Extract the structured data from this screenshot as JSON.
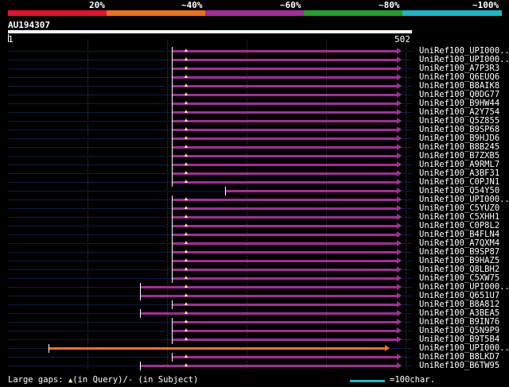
{
  "legend": {
    "labels": [
      "20%",
      "~40%",
      "~60%",
      "~80%",
      "~100%"
    ],
    "colors": [
      "#e8102a",
      "#ee7118",
      "#a82a9c",
      "#22a02a",
      "#18b8c8"
    ]
  },
  "query": {
    "id": "AU194307",
    "start": "1",
    "end": "502"
  },
  "colors": {
    "line": "#a82a9c",
    "context": "#0d1e45",
    "hit_orange": "#ee7118",
    "marker": "#ffee88"
  },
  "hits": [
    {
      "name": "UniRef100_UPI000..",
      "start": 216,
      "end": 505,
      "color": "purple"
    },
    {
      "name": "UniRef100_UPI000..",
      "start": 216,
      "end": 505,
      "color": "purple"
    },
    {
      "name": "UniRef100_A7P3R3",
      "start": 216,
      "end": 505,
      "color": "purple"
    },
    {
      "name": "UniRef100_Q6EUQ6",
      "start": 216,
      "end": 505,
      "color": "purple"
    },
    {
      "name": "UniRef100_B8AIK8",
      "start": 216,
      "end": 505,
      "color": "purple"
    },
    {
      "name": "UniRef100_Q0DG77",
      "start": 216,
      "end": 505,
      "color": "purple"
    },
    {
      "name": "UniRef100_B9HW44",
      "start": 216,
      "end": 505,
      "color": "purple"
    },
    {
      "name": "UniRef100_A2Y754",
      "start": 216,
      "end": 505,
      "color": "purple"
    },
    {
      "name": "UniRef100_Q5Z855",
      "start": 216,
      "end": 505,
      "color": "purple"
    },
    {
      "name": "UniRef100_B9SP68",
      "start": 216,
      "end": 505,
      "color": "purple"
    },
    {
      "name": "UniRef100_B9HJD6",
      "start": 216,
      "end": 505,
      "color": "purple"
    },
    {
      "name": "UniRef100_B8B245",
      "start": 216,
      "end": 505,
      "color": "purple"
    },
    {
      "name": "UniRef100_B7ZXB5",
      "start": 216,
      "end": 505,
      "color": "purple"
    },
    {
      "name": "UniRef100_A9RML7",
      "start": 216,
      "end": 505,
      "color": "purple"
    },
    {
      "name": "UniRef100_A3BF31",
      "start": 216,
      "end": 505,
      "color": "purple"
    },
    {
      "name": "UniRef100_C0PJN1",
      "start": 216,
      "end": 505,
      "color": "purple"
    },
    {
      "name": "UniRef100_Q54Y50",
      "start": 283,
      "end": 505,
      "color": "purple"
    },
    {
      "name": "UniRef100_UPI000..",
      "start": 216,
      "end": 505,
      "color": "purple"
    },
    {
      "name": "UniRef100_C5YUZ0",
      "start": 216,
      "end": 505,
      "color": "purple"
    },
    {
      "name": "UniRef100_C5XHH1",
      "start": 216,
      "end": 505,
      "color": "purple"
    },
    {
      "name": "UniRef100_C0P8L2",
      "start": 216,
      "end": 505,
      "color": "purple"
    },
    {
      "name": "UniRef100_B4FLN4",
      "start": 216,
      "end": 505,
      "color": "purple"
    },
    {
      "name": "UniRef100_A7QXM4",
      "start": 216,
      "end": 505,
      "color": "purple"
    },
    {
      "name": "UniRef100_B9SP87",
      "start": 216,
      "end": 505,
      "color": "purple"
    },
    {
      "name": "UniRef100_B9HAZ5",
      "start": 216,
      "end": 505,
      "color": "purple"
    },
    {
      "name": "UniRef100_Q8LBH2",
      "start": 216,
      "end": 505,
      "color": "purple"
    },
    {
      "name": "UniRef100_C5XW75",
      "start": 216,
      "end": 505,
      "color": "purple"
    },
    {
      "name": "UniRef100_UPI000..",
      "start": 176,
      "end": 505,
      "color": "purple"
    },
    {
      "name": "UniRef100_Q651U7",
      "start": 176,
      "end": 505,
      "color": "purple"
    },
    {
      "name": "UniRef100_B8A812",
      "start": 216,
      "end": 505,
      "color": "purple"
    },
    {
      "name": "UniRef100_A3BEA5",
      "start": 176,
      "end": 505,
      "color": "purple"
    },
    {
      "name": "UniRef100_B9IN76",
      "start": 216,
      "end": 505,
      "color": "purple"
    },
    {
      "name": "UniRef100_Q5N9P9",
      "start": 216,
      "end": 505,
      "color": "purple"
    },
    {
      "name": "UniRef100_B9T5B4",
      "start": 216,
      "end": 505,
      "color": "purple"
    },
    {
      "name": "UniRef100_UPI000..",
      "start": 61,
      "end": 490,
      "color": "orange"
    },
    {
      "name": "UniRef100_B8LKD7",
      "start": 216,
      "end": 505,
      "color": "purple"
    },
    {
      "name": "UniRef100_B6TW95",
      "start": 176,
      "end": 505,
      "color": "purple"
    }
  ],
  "footer": {
    "prefix": "Large gaps: ",
    "marker": "▲",
    "text": "(in Query)/- (in Subject)",
    "scale": "=100char."
  }
}
